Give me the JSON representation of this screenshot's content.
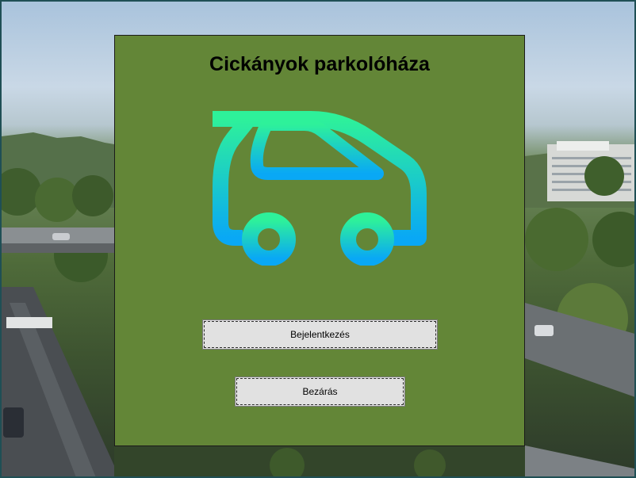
{
  "window": {
    "title": "Cickányok parkolóháza"
  },
  "panel": {
    "title": "Cickányok parkolóháza",
    "logo_icon": "car-icon",
    "logo_gradient": [
      "#2ef19a",
      "#09a8f5"
    ]
  },
  "buttons": {
    "login_label": "Bejelentkezés",
    "close_label": "Bezárás"
  },
  "colors": {
    "panel_background": "#638637",
    "button_background": "#e1e1e1",
    "window_border": "#1f4f55"
  }
}
